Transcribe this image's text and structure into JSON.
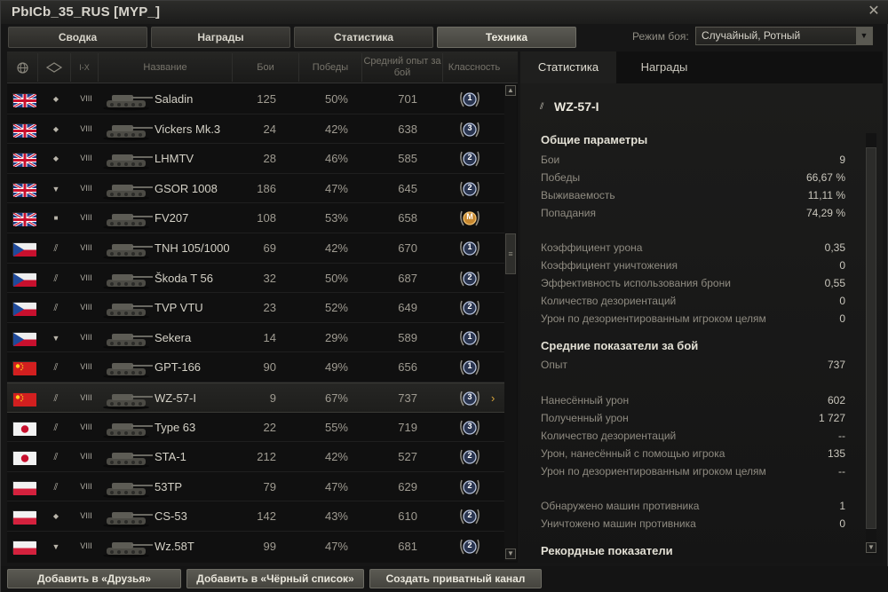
{
  "window": {
    "title": "PbICb_35_RUS [MYP_]",
    "close_icon": "close-icon"
  },
  "tabs": [
    {
      "label": "Сводка",
      "active": false
    },
    {
      "label": "Награды",
      "active": false
    },
    {
      "label": "Статистика",
      "active": false
    },
    {
      "label": "Техника",
      "active": true
    }
  ],
  "battle_mode": {
    "label": "Режим боя:",
    "value": "Случайный, Ротный"
  },
  "table": {
    "columns": {
      "nation_icon": "globe-icon",
      "type_icon": "vehicle-type-icon",
      "tier": "I-X",
      "name": "Название",
      "battles": "Бои",
      "wins": "Победы",
      "avg_xp": "Средний опыт за бой",
      "mastery": "Классность"
    },
    "rows": [
      {
        "nation": "uk",
        "type": "lt",
        "tier": "VIII",
        "name": "Saladin",
        "battles": "125",
        "wins": "50%",
        "xp": "701",
        "mark": "1",
        "selected": false
      },
      {
        "nation": "uk",
        "type": "lt",
        "tier": "VIII",
        "name": "Vickers Mk.3",
        "battles": "24",
        "wins": "42%",
        "xp": "638",
        "mark": "3",
        "selected": false
      },
      {
        "nation": "uk",
        "type": "lt",
        "tier": "VIII",
        "name": "LHMTV",
        "battles": "28",
        "wins": "46%",
        "xp": "585",
        "mark": "2",
        "selected": false
      },
      {
        "nation": "uk",
        "type": "td",
        "tier": "VIII",
        "name": "GSOR 1008",
        "battles": "186",
        "wins": "47%",
        "xp": "645",
        "mark": "2",
        "selected": false
      },
      {
        "nation": "uk",
        "type": "spg",
        "tier": "VIII",
        "name": "FV207",
        "battles": "108",
        "wins": "53%",
        "xp": "658",
        "mark": "M",
        "selected": false
      },
      {
        "nation": "cz",
        "type": "mt",
        "tier": "VIII",
        "name": "TNH 105/1000",
        "battles": "69",
        "wins": "42%",
        "xp": "670",
        "mark": "1",
        "selected": false
      },
      {
        "nation": "cz",
        "type": "mt",
        "tier": "VIII",
        "name": "Škoda T 56",
        "battles": "32",
        "wins": "50%",
        "xp": "687",
        "mark": "2",
        "selected": false
      },
      {
        "nation": "cz",
        "type": "mt",
        "tier": "VIII",
        "name": "TVP VTU",
        "battles": "23",
        "wins": "52%",
        "xp": "649",
        "mark": "2",
        "selected": false
      },
      {
        "nation": "cz",
        "type": "td",
        "tier": "VIII",
        "name": "Sekera",
        "battles": "14",
        "wins": "29%",
        "xp": "589",
        "mark": "1",
        "selected": false
      },
      {
        "nation": "cn",
        "type": "mt",
        "tier": "VIII",
        "name": "GPT-166",
        "battles": "90",
        "wins": "49%",
        "xp": "656",
        "mark": "1",
        "selected": false
      },
      {
        "nation": "cn",
        "type": "mt",
        "tier": "VIII",
        "name": "WZ-57-I",
        "battles": "9",
        "wins": "67%",
        "xp": "737",
        "mark": "3",
        "selected": true
      },
      {
        "nation": "jp",
        "type": "mt",
        "tier": "VIII",
        "name": "Type 63",
        "battles": "22",
        "wins": "55%",
        "xp": "719",
        "mark": "3",
        "selected": false
      },
      {
        "nation": "jp",
        "type": "mt",
        "tier": "VIII",
        "name": "STA-1",
        "battles": "212",
        "wins": "42%",
        "xp": "527",
        "mark": "2",
        "selected": false
      },
      {
        "nation": "pl",
        "type": "mt",
        "tier": "VIII",
        "name": "53TP",
        "battles": "79",
        "wins": "47%",
        "xp": "629",
        "mark": "2",
        "selected": false
      },
      {
        "nation": "pl",
        "type": "lt",
        "tier": "VIII",
        "name": "CS-53",
        "battles": "142",
        "wins": "43%",
        "xp": "610",
        "mark": "2",
        "selected": false
      },
      {
        "nation": "pl",
        "type": "td",
        "tier": "VIII",
        "name": "Wz.58T",
        "battles": "99",
        "wins": "47%",
        "xp": "681",
        "mark": "2",
        "selected": false
      }
    ]
  },
  "details": {
    "tabs": [
      {
        "label": "Статистика",
        "active": true
      },
      {
        "label": "Награды",
        "active": false
      }
    ],
    "vehicle_name": "WZ-57-I",
    "general_title": "Общие параметры",
    "general": [
      {
        "label": "Бои",
        "value": "9"
      },
      {
        "label": "Победы",
        "value": "66,67 %"
      },
      {
        "label": "Выживаемость",
        "value": "11,11 %"
      },
      {
        "label": "Попадания",
        "value": "74,29 %"
      }
    ],
    "ratios": [
      {
        "label": "Коэффициент урона",
        "value": "0,35"
      },
      {
        "label": "Коэффициент уничтожения",
        "value": "0"
      },
      {
        "label": "Эффективность использования брони",
        "value": "0,55"
      },
      {
        "label": "Количество дезориентаций",
        "value": "0"
      },
      {
        "label": "Урон по дезориентированным игроком целям",
        "value": "0"
      }
    ],
    "avg_title": "Средние показатели за бой",
    "avg_xp": {
      "label": "Опыт",
      "value": "737"
    },
    "damage": [
      {
        "label": "Нанесённый урон",
        "value": "602"
      },
      {
        "label": "Полученный урон",
        "value": "1 727"
      },
      {
        "label": "Количество дезориентаций",
        "value": "--"
      },
      {
        "label": "Урон, нанесённый с помощью игрока",
        "value": "135"
      },
      {
        "label": "Урон по дезориентированным игроком целям",
        "value": "--"
      }
    ],
    "kills": [
      {
        "label": "Обнаружено машин противника",
        "value": "1"
      },
      {
        "label": "Уничтожено машин противника",
        "value": "0"
      }
    ],
    "records_title": "Рекордные показатели"
  },
  "buttons": {
    "add_friend": "Добавить в «Друзья»",
    "add_blacklist": "Добавить в «Чёрный список»",
    "private_channel": "Создать приватный канал"
  }
}
